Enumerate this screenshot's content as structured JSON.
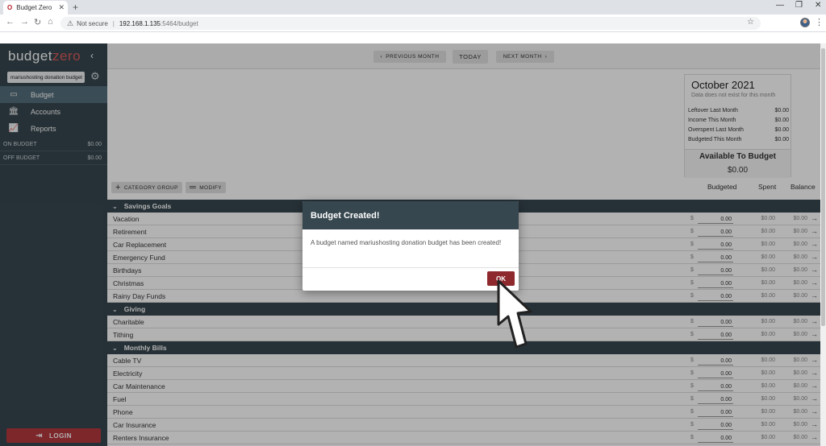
{
  "browser": {
    "tab_title": "Budget Zero",
    "tab_favicon": "O",
    "security_label": "Not secure",
    "url_host": "192.168.1.135",
    "url_path": ":5464/budget"
  },
  "sidebar": {
    "logo_main": "budget",
    "logo_accent": "zero",
    "budget_name": "mariushosting donation budget",
    "nav": [
      {
        "label": "Budget",
        "icon": "budget-icon"
      },
      {
        "label": "Accounts",
        "icon": "bank-icon"
      },
      {
        "label": "Reports",
        "icon": "chart-icon"
      }
    ],
    "on_budget_label": "ON BUDGET",
    "on_budget_value": "$0.00",
    "off_budget_label": "OFF BUDGET",
    "off_budget_value": "$0.00",
    "login_label": "LOGIN"
  },
  "month_nav": {
    "prev_label": "PREVIOUS MONTH",
    "today_label": "TODAY",
    "next_label": "NEXT MONTH"
  },
  "month_card": {
    "title": "October 2021",
    "subtitle": "Data does not exist for this month",
    "rows": [
      {
        "label": "Leftover Last Month",
        "value": "$0.00"
      },
      {
        "label": "Income This Month",
        "value": "$0.00"
      },
      {
        "label": "Overspent Last Month",
        "value": "$0.00"
      },
      {
        "label": "Budgeted This Month",
        "value": "$0.00"
      }
    ],
    "available_label": "Available To Budget",
    "available_value": "$0.00"
  },
  "actions": {
    "category_group_label": "CATEGORY GROUP",
    "modify_label": "MODIFY"
  },
  "columns": {
    "budgeted": "Budgeted",
    "spent": "Spent",
    "balance": "Balance"
  },
  "groups": [
    {
      "name": "Savings Goals",
      "categories": [
        "Vacation",
        "Retirement",
        "Car Replacement",
        "Emergency Fund",
        "Birthdays",
        "Christmas",
        "Rainy Day Funds"
      ]
    },
    {
      "name": "Giving",
      "categories": [
        "Charitable",
        "Tithing"
      ]
    },
    {
      "name": "Monthly Bills",
      "categories": [
        "Cable TV",
        "Electricity",
        "Car Maintenance",
        "Fuel",
        "Phone",
        "Car Insurance",
        "Renters Insurance"
      ]
    }
  ],
  "row_values": {
    "currency": "$",
    "budgeted": "0.00",
    "spent": "$0.00",
    "balance": "$0.00"
  },
  "modal": {
    "title": "Budget Created!",
    "message": "A budget named mariushosting donation budget has been created!",
    "ok_label": "OK"
  }
}
